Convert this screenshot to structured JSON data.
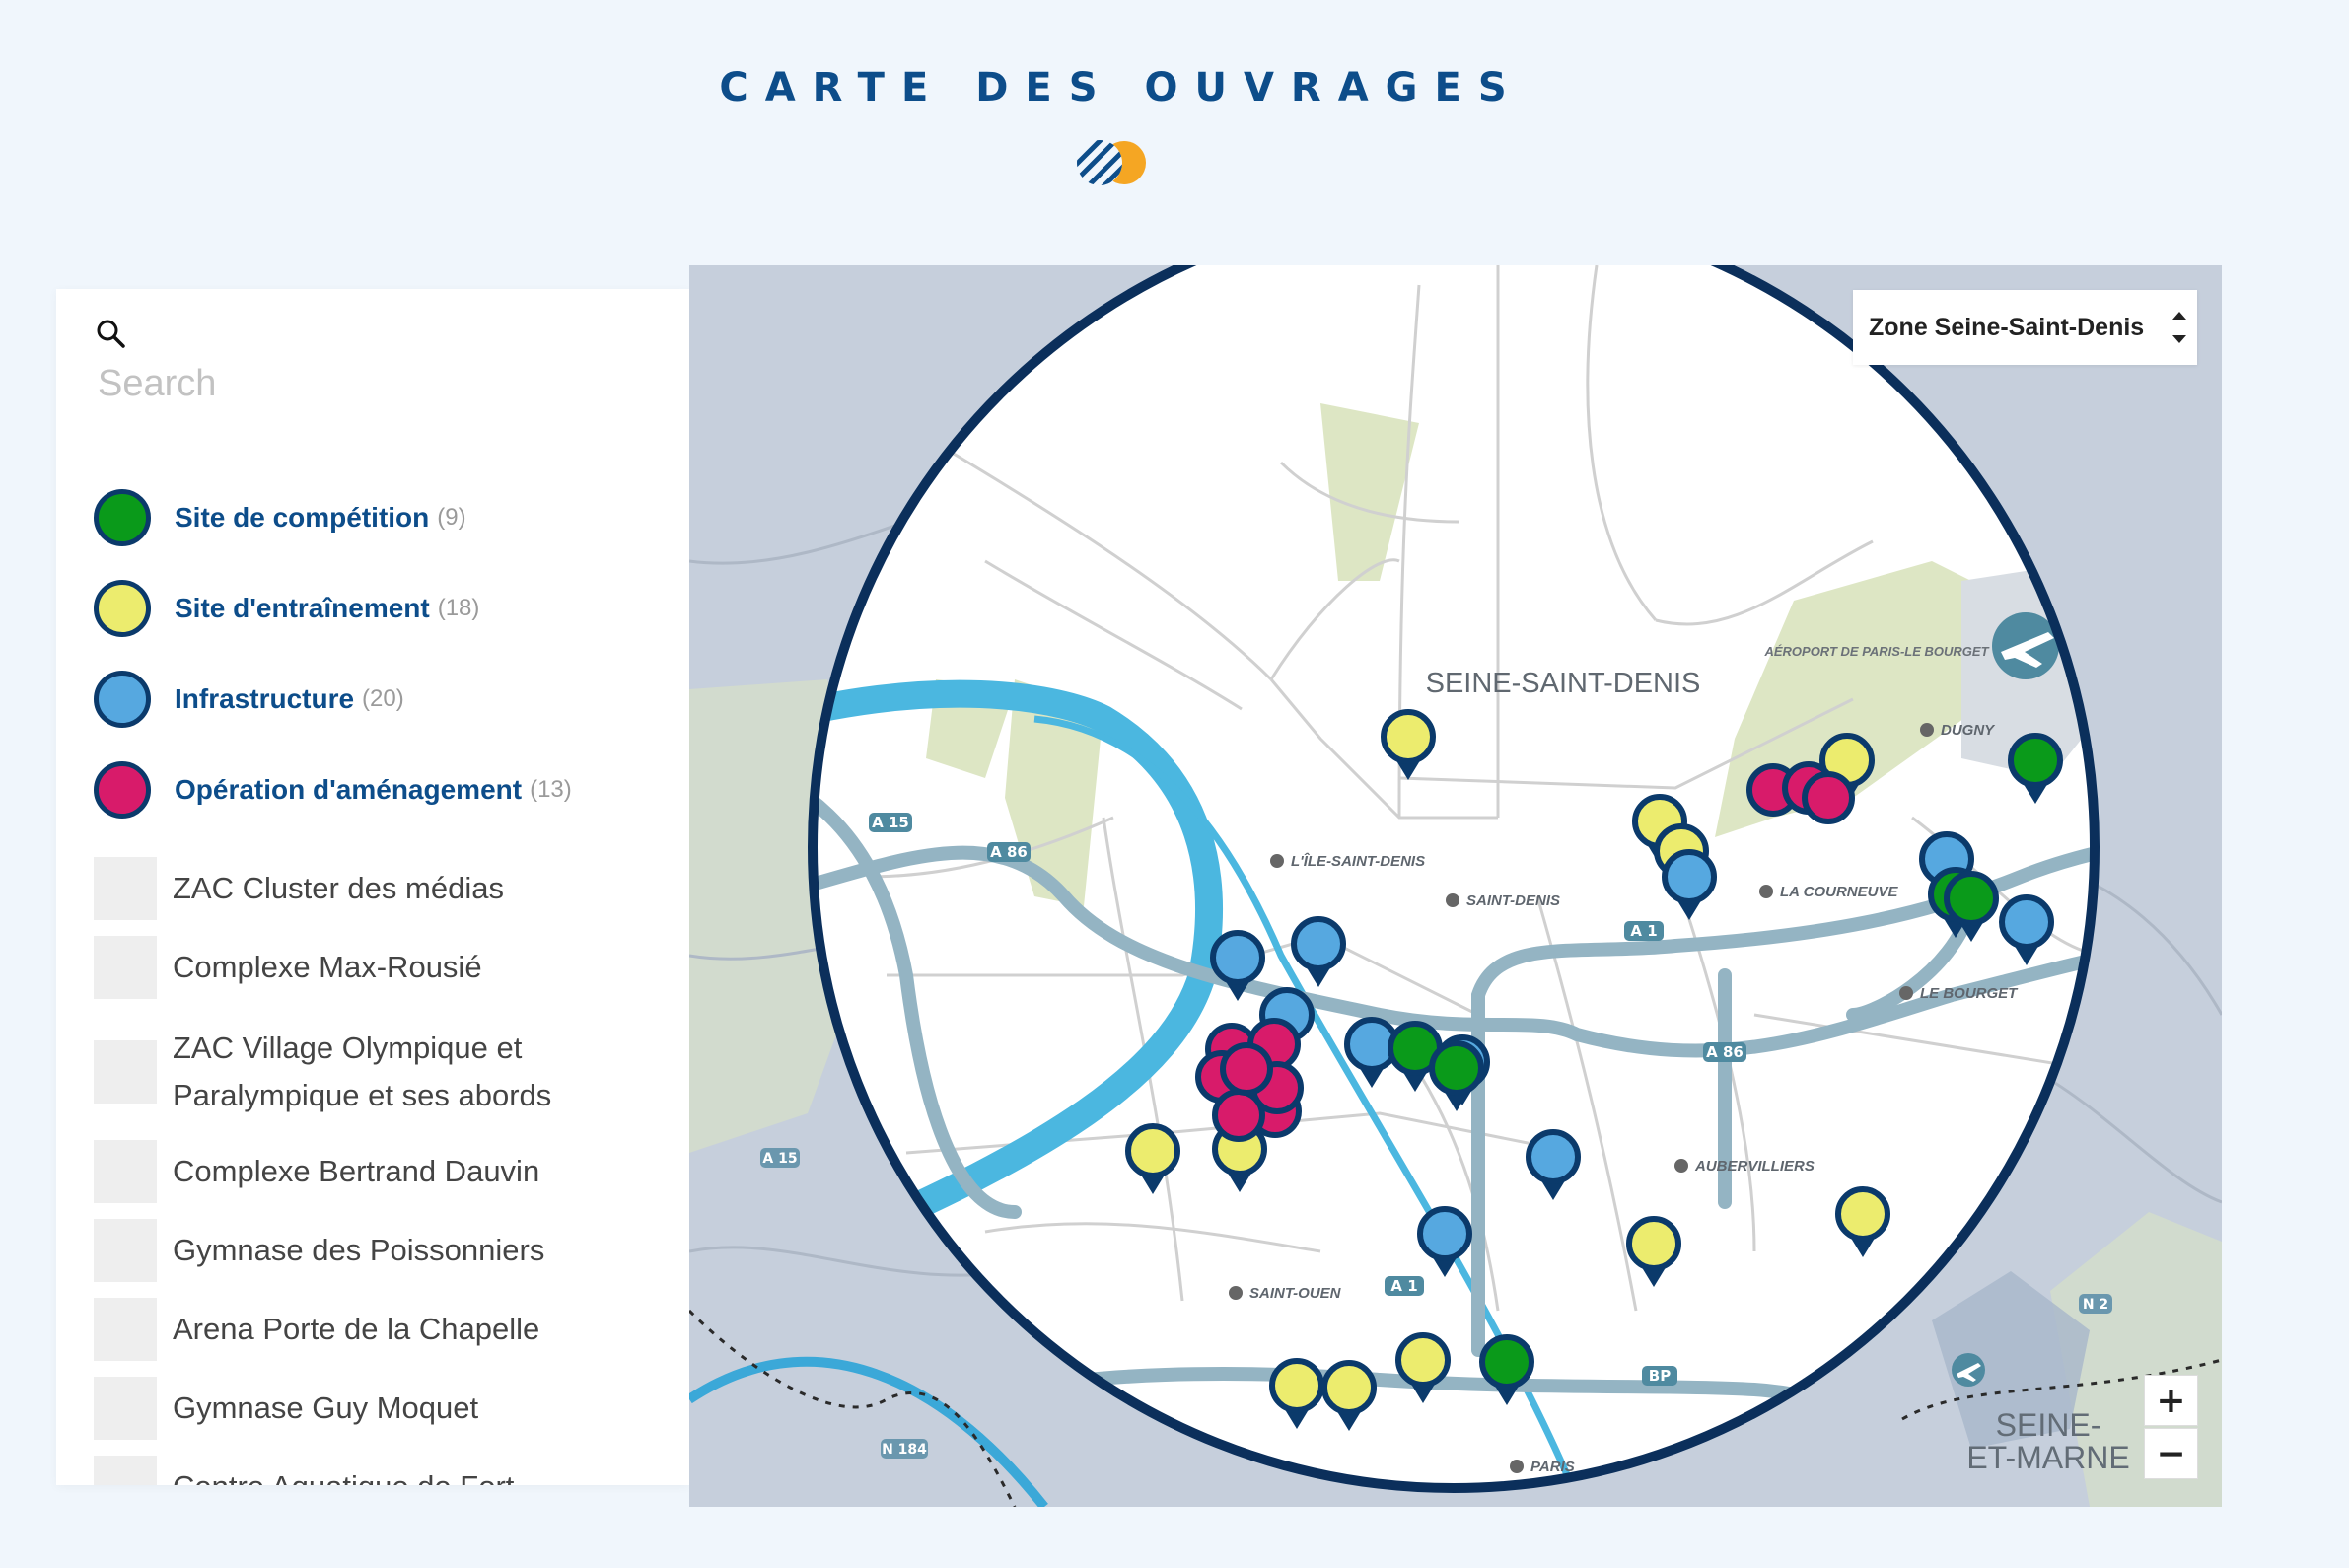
{
  "page": {
    "title": "CARTE DES OUVRAGES"
  },
  "colors": {
    "competition": "#0a9a1a",
    "entrainement": "#ecec6e",
    "infrastructure": "#56a8e0",
    "amenagement": "#d81b6a",
    "title": "#0d4d8a",
    "outline": "#0b3a6b"
  },
  "sidebar": {
    "search_icon": "search-icon",
    "search_placeholder": "Search",
    "legend": [
      {
        "label": "Site de compétition",
        "count": "(9)",
        "color": "#0a9a1a"
      },
      {
        "label": "Site d'entraînement",
        "count": "(18)",
        "color": "#ecec6e"
      },
      {
        "label": "Infrastructure",
        "count": "(20)",
        "color": "#56a8e0"
      },
      {
        "label": "Opération d'aménagement",
        "count": "(13)",
        "color": "#d81b6a"
      }
    ],
    "places": [
      "ZAC Cluster des médias",
      "Complexe Max-Rousié",
      "ZAC Village Olympique et Paralympique et ses abords",
      "Complexe Bertrand Dauvin",
      "Gymnase des Poissonniers",
      "Arena Porte de la Chapelle",
      "Gymnase Guy Moquet",
      "Centre Aquatique de Fort"
    ]
  },
  "map": {
    "zone_select": "Zone Seine-Saint-Denis",
    "zoom_in": "+",
    "zoom_out": "−",
    "region_label": "SEINE-SAINT-DENIS",
    "outer_region_label_1": "SEINE-",
    "outer_region_label_2": "ET-MARNE",
    "airport_label": "AÉROPORT DE PARIS-LE BOURGET",
    "towns": [
      "L'ÎLE-SAINT-DENIS",
      "SAINT-DENIS",
      "LA COURNEUVE",
      "DUGNY",
      "LE BOURGET",
      "AUBERVILLIERS",
      "SAINT-OUEN",
      "PARIS"
    ],
    "road_labels": [
      "A 15",
      "A 86",
      "A 1",
      "A 86",
      "A 15",
      "A 1",
      "BP",
      "N 184",
      "N 2"
    ]
  }
}
